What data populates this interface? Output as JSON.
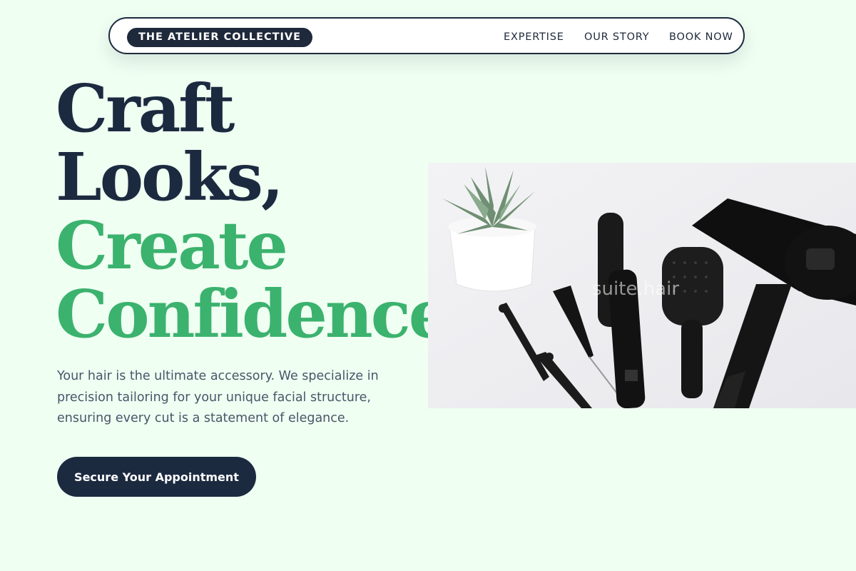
{
  "brand": {
    "logo_text": "THE ATELIER COLLECTIVE"
  },
  "nav": {
    "items": [
      {
        "label": "EXPERTISE"
      },
      {
        "label": "OUR STORY"
      },
      {
        "label": "BOOK NOW"
      }
    ]
  },
  "hero": {
    "headline_line1": "Craft",
    "headline_line2": "Looks,",
    "headline_line3": "Create",
    "headline_line4": "Confidence.",
    "description": "Your hair is the ultimate accessory. We specialize in precision tailoring for your unique facial structure, ensuring every cut is a statement of elegance.",
    "cta_label": "Secure Your Appointment",
    "image_watermark": "suite.hair"
  },
  "colors": {
    "background": "#effff2",
    "navy": "#1c2a40",
    "accent_green": "#3bb26e",
    "body_text": "#4a5568"
  }
}
